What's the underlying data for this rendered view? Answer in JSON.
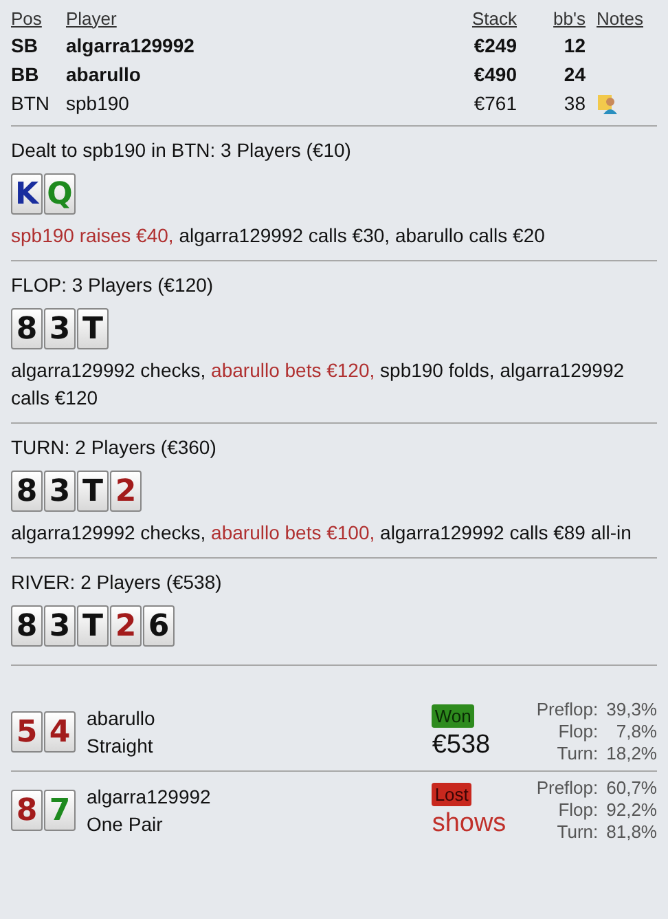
{
  "players_table": {
    "columns": [
      "Pos",
      "Player",
      "Stack",
      "bb's",
      "Notes"
    ],
    "rows": [
      {
        "pos": "SB",
        "player": "algarra129992",
        "stack": "€249",
        "bbs": "12",
        "bold": true,
        "note": false
      },
      {
        "pos": "BB",
        "player": "abarullo",
        "stack": "€490",
        "bbs": "24",
        "bold": true,
        "note": false
      },
      {
        "pos": "BTN",
        "player": "spb190",
        "stack": "€761",
        "bbs": "38",
        "bold": false,
        "note": true
      }
    ]
  },
  "streets": [
    {
      "heading": "Dealt to spb190 in BTN: 3 Players (€10)",
      "cards": [
        {
          "rank": "K",
          "color": "#1a2e9e"
        },
        {
          "rank": "Q",
          "color": "#1e8a1e"
        }
      ],
      "actions": [
        {
          "text": "spb190 raises €40,",
          "aggressive": true
        },
        {
          "text": "algarra129992 calls €30,",
          "aggressive": false
        },
        {
          "text": "abarullo calls €20",
          "aggressive": false
        }
      ]
    },
    {
      "heading": "FLOP: 3 Players (€120)",
      "cards": [
        {
          "rank": "8",
          "color": "#111111"
        },
        {
          "rank": "3",
          "color": "#111111"
        },
        {
          "rank": "T",
          "color": "#111111"
        }
      ],
      "actions": [
        {
          "text": "algarra129992 checks,",
          "aggressive": false
        },
        {
          "text": "abarullo bets €120,",
          "aggressive": true
        },
        {
          "text": "spb190 folds,",
          "aggressive": false
        },
        {
          "text": "algarra129992 calls €120",
          "aggressive": false
        }
      ]
    },
    {
      "heading": "TURN: 2 Players (€360)",
      "cards": [
        {
          "rank": "8",
          "color": "#111111"
        },
        {
          "rank": "3",
          "color": "#111111"
        },
        {
          "rank": "T",
          "color": "#111111"
        },
        {
          "rank": "2",
          "color": "#a31c1c"
        }
      ],
      "actions": [
        {
          "text": "algarra129992 checks,",
          "aggressive": false
        },
        {
          "text": "abarullo bets €100,",
          "aggressive": true
        },
        {
          "text": "algarra129992 calls €89 all-in",
          "aggressive": false
        }
      ]
    },
    {
      "heading": "RIVER: 2 Players (€538)",
      "cards": [
        {
          "rank": "8",
          "color": "#111111"
        },
        {
          "rank": "3",
          "color": "#111111"
        },
        {
          "rank": "T",
          "color": "#111111"
        },
        {
          "rank": "2",
          "color": "#a31c1c"
        },
        {
          "rank": "6",
          "color": "#111111"
        }
      ]
    }
  ],
  "showdown": [
    {
      "player": "abarullo",
      "hand": "Straight",
      "result": "Won",
      "won": true,
      "amount": "€538",
      "cards": [
        {
          "rank": "5",
          "color": "#a31c1c"
        },
        {
          "rank": "4",
          "color": "#a31c1c"
        }
      ],
      "equity": [
        {
          "label": "Preflop:",
          "value": "39,3%"
        },
        {
          "label": "Flop:",
          "value": "7,8%"
        },
        {
          "label": "Turn:",
          "value": "18,2%"
        }
      ]
    },
    {
      "player": "algarra129992",
      "hand": "One Pair",
      "result": "Lost",
      "won": false,
      "amount": "shows",
      "cards": [
        {
          "rank": "8",
          "color": "#a31c1c"
        },
        {
          "rank": "7",
          "color": "#1e8a1e"
        }
      ],
      "equity": [
        {
          "label": "Preflop:",
          "value": "60,7%"
        },
        {
          "label": "Flop:",
          "value": "92,2%"
        },
        {
          "label": "Turn:",
          "value": "81,8%"
        }
      ]
    }
  ]
}
